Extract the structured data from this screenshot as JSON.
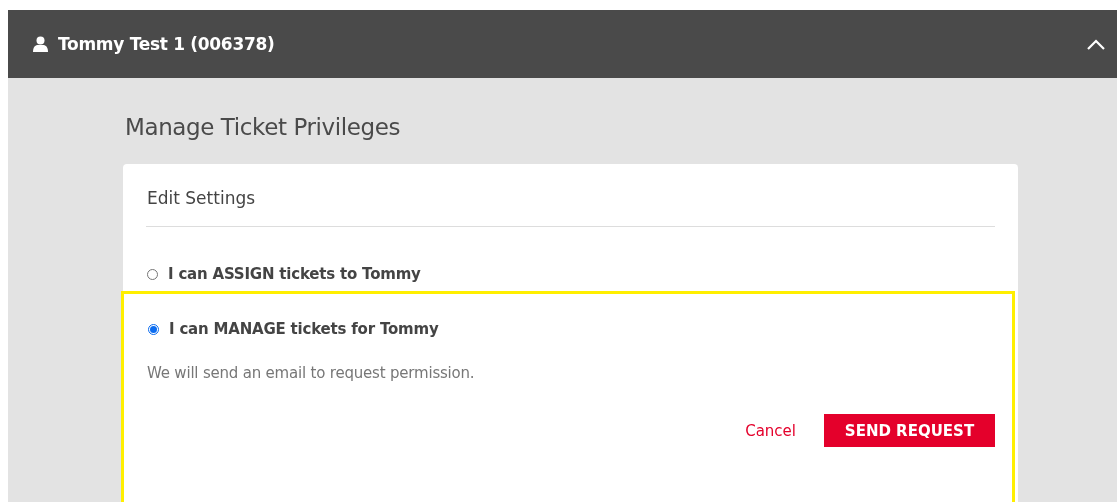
{
  "header": {
    "title": "Tommy Test 1 (006378)",
    "expanded": true
  },
  "page_title": "Manage Ticket Privileges",
  "card": {
    "title": "Edit Settings",
    "options": [
      {
        "label": "I can ASSIGN tickets to Tommy",
        "selected": false
      },
      {
        "label": "I can MANAGE tickets for Tommy",
        "selected": true
      }
    ],
    "note": "We will send an email to request permission.",
    "buttons": [
      {
        "label": "Cancel",
        "kind": "link"
      },
      {
        "label": "SEND REQUEST",
        "kind": "primary"
      }
    ]
  }
}
